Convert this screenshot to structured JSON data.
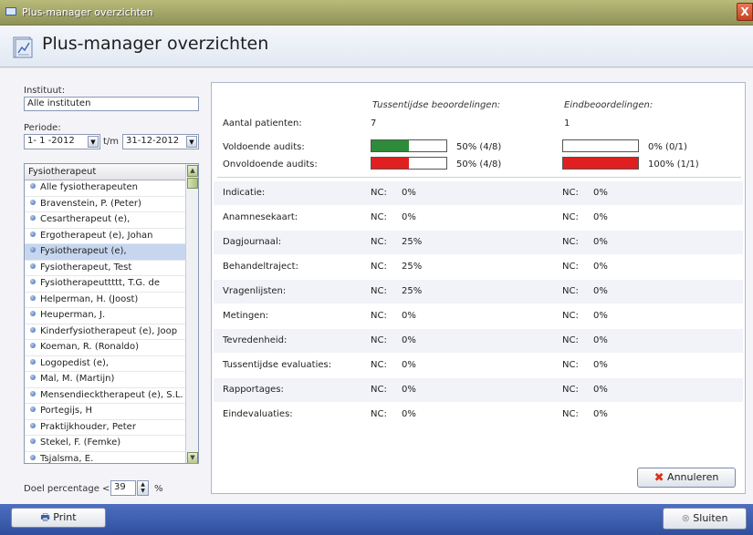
{
  "window": {
    "title": "Plus-manager overzichten",
    "close_label": "X"
  },
  "header": {
    "title": "Plus-manager overzichten"
  },
  "filters": {
    "instituut_label": "Instituut:",
    "instituut_value": "Alle instituten",
    "periode_label": "Periode:",
    "periode_from": "1- 1 -2012",
    "periode_sep": "t/m",
    "periode_to": "31-12-2012"
  },
  "therapist_list": {
    "header": "Fysiotherapeut",
    "items": [
      "Alle fysiotherapeuten",
      "Bravenstein, P.  (Peter)",
      "Cesartherapeut (e),",
      "Ergotherapeut (e), Johan",
      "Fysiotherapeut (e),",
      "Fysiotherapeut, Test",
      "Fysiotherapeuttttt, T.G. de",
      "Helperman, H.  (Joost)",
      "Heuperman, J.",
      "Kinderfysiotherapeut (e), Joop",
      "Koeman, R.  (Ronaldo)",
      "Logopedist (e),",
      "Mal, M.  (Martijn)",
      "Mensendiecktherapeut (e), S.L.",
      "Portegijs, H",
      "Praktijkhouder, Peter",
      "Stekel, F.  (Femke)",
      "Tsjalsma, E."
    ],
    "selected_index": 4
  },
  "doel": {
    "label": "Doel percentage <",
    "value": "39",
    "unit": "%"
  },
  "summary": {
    "col1_header": "Tussentijdse beoordelingen:",
    "col2_header": "Eindbeoordelingen:",
    "aantal_label": "Aantal patienten:",
    "aantal_col1": "7",
    "aantal_col2": "1",
    "voldoende_label": "Voldoende audits:",
    "voldoende_col1_text": "50% (4/8)",
    "voldoende_col2_text": "0% (0/1)",
    "voldoende_col1_fraction": 0.5,
    "voldoende_col2_fraction": 0.0,
    "onvoldoende_label": "Onvoldoende audits:",
    "onvoldoende_col1_text": "50% (4/8)",
    "onvoldoende_col2_text": "100% (1/1)",
    "onvoldoende_col1_fraction": 0.5,
    "onvoldoende_col2_fraction": 1.0,
    "green": "#2e8b3a",
    "red": "#e02020"
  },
  "details": {
    "nc_label": "NC:",
    "rows": [
      {
        "label": "Indicatie:",
        "col1": "0%",
        "col2": "0%"
      },
      {
        "label": "Anamnesekaart:",
        "col1": "0%",
        "col2": "0%"
      },
      {
        "label": "Dagjournaal:",
        "col1": "25%",
        "col2": "0%"
      },
      {
        "label": "Behandeltraject:",
        "col1": "25%",
        "col2": "0%"
      },
      {
        "label": "Vragenlijsten:",
        "col1": "25%",
        "col2": "0%"
      },
      {
        "label": "Metingen:",
        "col1": "0%",
        "col2": "0%"
      },
      {
        "label": "Tevredenheid:",
        "col1": "0%",
        "col2": "0%"
      },
      {
        "label": "Tussentijdse evaluaties:",
        "col1": "0%",
        "col2": "0%"
      },
      {
        "label": "Rapportages:",
        "col1": "0%",
        "col2": "0%"
      },
      {
        "label": "Eindevaluaties:",
        "col1": "0%",
        "col2": "0%"
      }
    ]
  },
  "buttons": {
    "annuleren": "Annuleren",
    "print": "Print",
    "sluiten": "Sluiten"
  }
}
